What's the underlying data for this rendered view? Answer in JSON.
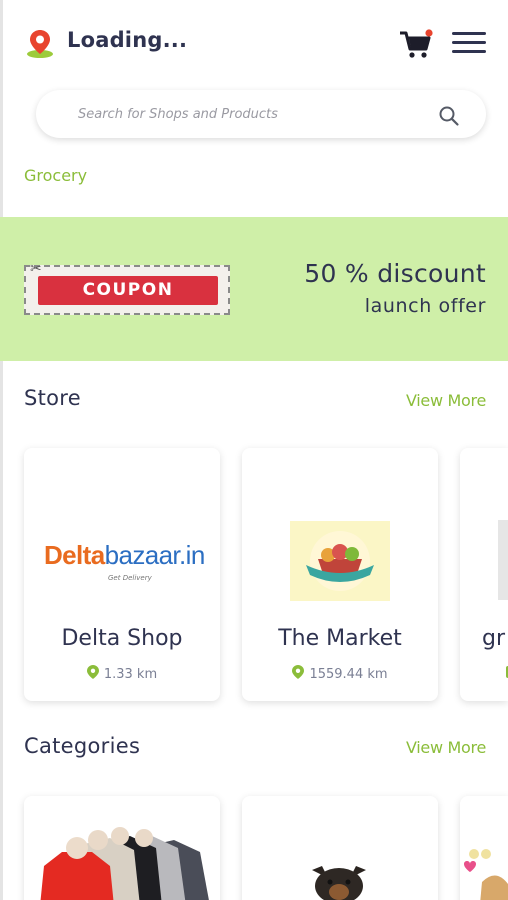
{
  "header": {
    "location_text": "Loading...",
    "location_icon": "location-pin-icon",
    "cart_icon": "cart-icon",
    "menu_icon": "hamburger-menu-icon"
  },
  "search": {
    "placeholder": "Search for Shops and Products",
    "icon": "search-icon"
  },
  "category_chip": "Grocery",
  "banner": {
    "coupon_label": "COUPON",
    "discount_text": "50 % discount",
    "offer_text": "launch offer",
    "background_color": "#cfefa8",
    "coupon_color": "#d9313f"
  },
  "stores": {
    "title": "Store",
    "view_more": "View More",
    "items": [
      {
        "name": "Delta Shop",
        "distance": "1.33 km",
        "logo_text": {
          "main": "Delta",
          "accent": "bazaar.in",
          "tagline": "Get Delivery"
        }
      },
      {
        "name": "The Market",
        "distance": "1559.44 km"
      },
      {
        "name": "gr",
        "distance": ""
      }
    ]
  },
  "categories": {
    "title": "Categories",
    "view_more": "View More"
  },
  "colors": {
    "accent_green": "#8bbd3a",
    "text_dark": "#2f3350",
    "pin_red": "#e8442e"
  }
}
